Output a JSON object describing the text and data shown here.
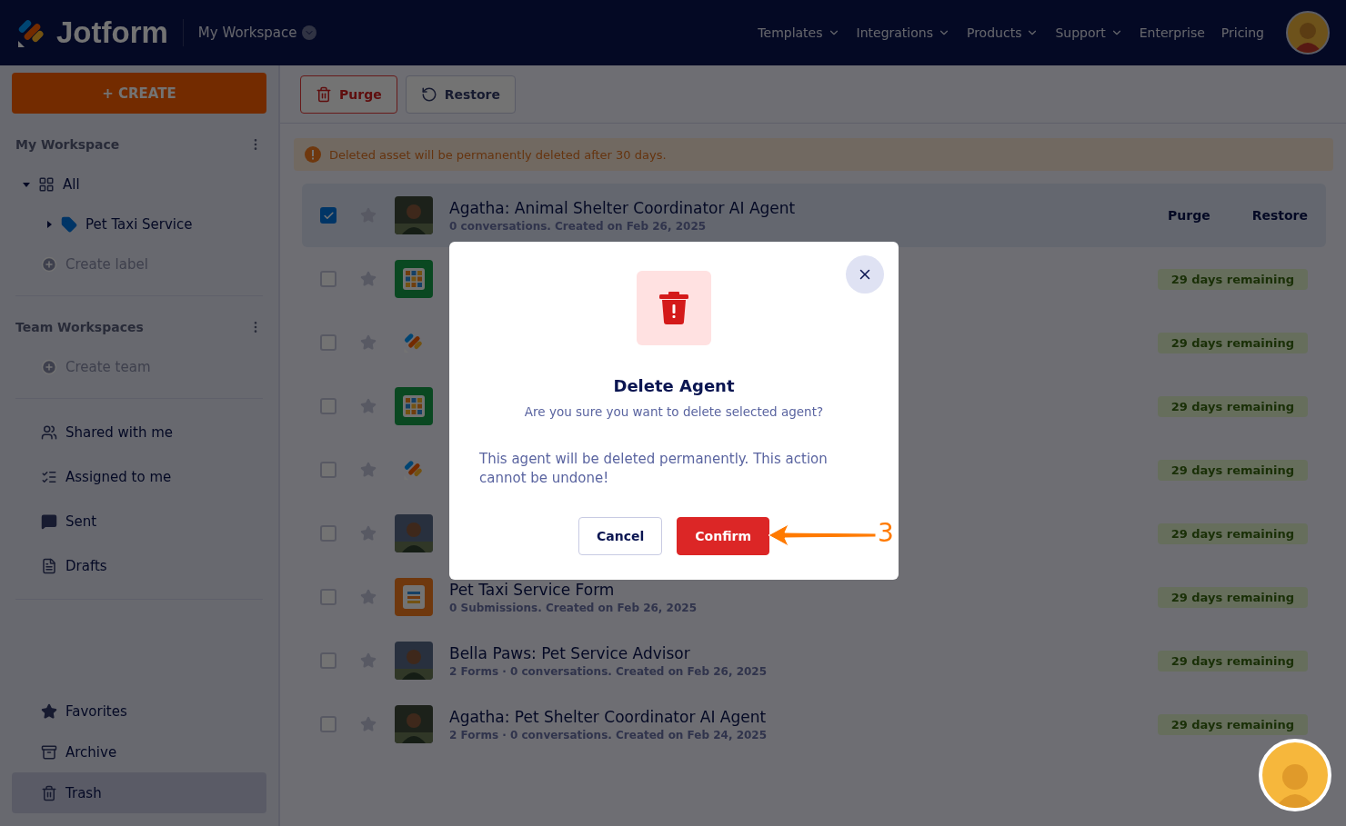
{
  "header": {
    "logo": "Jotform",
    "workspace": "My Workspace",
    "nav": [
      {
        "label": "Templates",
        "dropdown": true
      },
      {
        "label": "Integrations",
        "dropdown": true
      },
      {
        "label": "Products",
        "dropdown": true
      },
      {
        "label": "Support",
        "dropdown": true
      },
      {
        "label": "Enterprise",
        "dropdown": false
      },
      {
        "label": "Pricing",
        "dropdown": false
      }
    ]
  },
  "sidebar": {
    "create": "+ CREATE",
    "groups": [
      {
        "title": "My Workspace",
        "tree": [
          {
            "label": "All",
            "kind": "all",
            "expanded": true,
            "children": [
              {
                "label": "Pet Taxi Service",
                "kind": "label",
                "expanded": false
              }
            ]
          }
        ],
        "action": "Create label"
      },
      {
        "title": "Team Workspaces",
        "action": "Create team"
      }
    ],
    "links": [
      {
        "label": "Shared with me",
        "kind": "shared",
        "selected": false
      },
      {
        "label": "Assigned to me",
        "kind": "assigned",
        "selected": false
      },
      {
        "label": "Sent",
        "kind": "sent",
        "selected": false
      },
      {
        "label": "Drafts",
        "kind": "drafts",
        "selected": false
      }
    ],
    "bottom_links": [
      {
        "label": "Favorites",
        "kind": "favorites",
        "selected": false
      },
      {
        "label": "Archive",
        "kind": "archive",
        "selected": false
      },
      {
        "label": "Trash",
        "kind": "trash",
        "selected": true
      }
    ]
  },
  "toolbar": [
    {
      "label": "Purge",
      "kind": "purge"
    },
    {
      "label": "Restore",
      "kind": "restore"
    }
  ],
  "notice": "Deleted asset will be permanently deleted after 30 days.",
  "rows": [
    {
      "kind": "agent",
      "checked": true,
      "title": "Agatha: Animal Shelter Coordinator AI Agent",
      "subtitle": "0 conversations. Created on Feb 26, 2025",
      "actions": [
        "Purge",
        "Restore"
      ]
    },
    {
      "kind": "table",
      "checked": false,
      "badge": "29 days remaining"
    },
    {
      "kind": "app",
      "checked": false,
      "badge": "29 days remaining"
    },
    {
      "kind": "table",
      "checked": false,
      "badge": "29 days remaining"
    },
    {
      "kind": "app",
      "checked": false,
      "badge": "29 days remaining"
    },
    {
      "kind": "agent",
      "checked": false,
      "badge": "29 days remaining"
    },
    {
      "kind": "form",
      "checked": false,
      "title": "Pet Taxi Service Form",
      "subtitle": "0 Submissions. Created on Feb 26, 2025",
      "badge": "29 days remaining"
    },
    {
      "kind": "agent",
      "checked": false,
      "title": "Bella Paws: Pet Service Advisor",
      "subtitle": "2 Forms · 0 conversations. Created on Feb 26, 2025",
      "badge": "29 days remaining"
    },
    {
      "kind": "agent",
      "checked": false,
      "title": "Agatha: Pet Shelter Coordinator AI Agent",
      "subtitle": "2 Forms · 0 conversations. Created on Feb 24, 2025",
      "badge": "29 days remaining"
    }
  ],
  "dialog": {
    "title": "Delete Agent",
    "question": "Are you sure you want to delete selected agent?",
    "warning": "This agent will be deleted permanently. This action cannot be undone!",
    "cancel": "Cancel",
    "confirm": "Confirm"
  },
  "annotation": {
    "step": "3"
  }
}
